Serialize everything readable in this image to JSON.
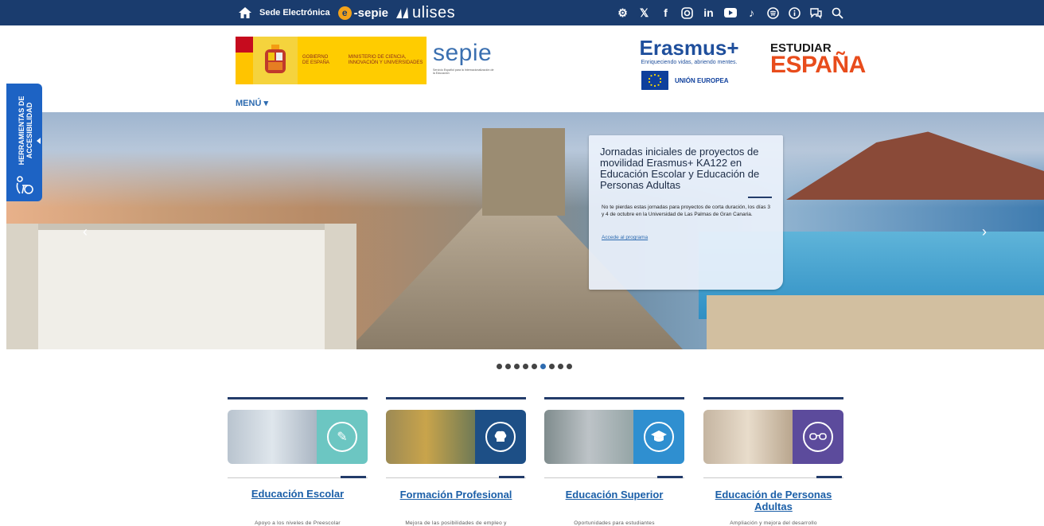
{
  "topbar": {
    "sede_label": "Sede Electrónica",
    "esepie_letter": "e",
    "esepie_label": "-sepie",
    "ulises_label": "ulises",
    "social_icons": [
      "settings-people-icon",
      "x-icon",
      "facebook-icon",
      "instagram-icon",
      "linkedin-icon",
      "youtube-icon",
      "tiktok-icon",
      "spotify-icon",
      "info-icon",
      "chat-icon",
      "search-icon"
    ]
  },
  "header": {
    "gov_line1": "Gobierno de España",
    "gov_line2": "Ministerio de Ciencia, Innovación y Universidades",
    "sepie_word": "sepie",
    "sepie_sub": "Servicio Español para la Internacionalización de la Educación",
    "erasmus_name": "Erasmus+",
    "erasmus_slogan": "Enriqueciendo vidas, abriendo mentes.",
    "eu_label": "UNIÓN EUROPEA",
    "estudiar_l1": "ESTUDIAR",
    "estudiar_l2": "ESPAÑA",
    "menu_label": "MENÚ ▾"
  },
  "accessibility": {
    "label": "HERRAMIENTAS DE ACCESIBILIDAD"
  },
  "hero": {
    "title": "Jornadas iniciales de proyectos de movilidad Erasmus+ KA122 en Educación Escolar y Educación de Personas Adultas",
    "body": "No te pierdas estas jornadas para proyectos de corta duración, los días 3 y 4 de octubre en la Universidad de Las Palmas de Gran Canaria.",
    "link": "Accede al programa",
    "slide_count": 9,
    "active_slide": 6
  },
  "cards": [
    {
      "heading": "Educación Escolar",
      "desc": "Apoyo a los niveles de Preescolar",
      "icon": "pencil-icon",
      "tile_color": "#6cc6c2"
    },
    {
      "heading": "Formación Profesional",
      "desc": "Mejora de las posibilidades de empleo y",
      "icon": "chef-hat-icon",
      "tile_color": "#1d4f86"
    },
    {
      "heading": "Educación Superior",
      "desc": "Oportunidades para estudiantes",
      "icon": "graduation-cap-icon",
      "tile_color": "#2f8fd0"
    },
    {
      "heading": "Educación de Personas Adultas",
      "desc": "Ampliación y mejora del desarrollo",
      "icon": "glasses-icon",
      "tile_color": "#5c4b9c"
    }
  ],
  "colors": {
    "topbar": "#1a3c6e",
    "accent": "#2d6bb0",
    "a11y_tab": "#1d63c4"
  }
}
